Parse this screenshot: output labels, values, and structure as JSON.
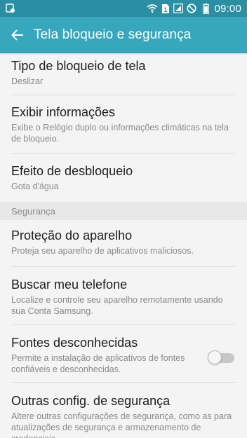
{
  "status_bar": {
    "time": "09:00",
    "sim_badge": "1",
    "icons": [
      "notification-icon",
      "wifi-icon",
      "sim-icon",
      "signal-icon",
      "no-sync-icon",
      "battery-icon"
    ]
  },
  "app_bar": {
    "title": "Tela bloqueio e segurança",
    "back_icon": "arrow-back-icon"
  },
  "items": [
    {
      "title": "Tipo de bloqueio de tela",
      "subtitle": "Deslizar"
    },
    {
      "title": "Exibir informações",
      "subtitle": "Exibe o Relógio duplo ou informações climáticas na tela de bloqueio."
    },
    {
      "title": "Efeito de desbloqueio",
      "subtitle": "Gota d'água"
    }
  ],
  "section": {
    "label": "Segurança"
  },
  "security_items": [
    {
      "title": "Proteção do aparelho",
      "subtitle": "Proteja seu aparelho de aplicativos maliciosos."
    },
    {
      "title": "Buscar meu telefone",
      "subtitle": "Localize e controle seu aparelho remotamente usando sua Conta Samsung."
    },
    {
      "title": "Fontes desconhecidas",
      "subtitle": "Permite a instalação de aplicativos de fontes confiáveis e desconhecidas.",
      "toggle_on": false
    },
    {
      "title": "Outras config. de segurança",
      "subtitle": "Altere outras configurações de segurança, como as para atualizações de segurança e armazenamento de credenciais."
    }
  ],
  "colors": {
    "status_bar": "#2a8fa3",
    "app_bar": "#37a7bd",
    "background": "#f4f4f4"
  }
}
